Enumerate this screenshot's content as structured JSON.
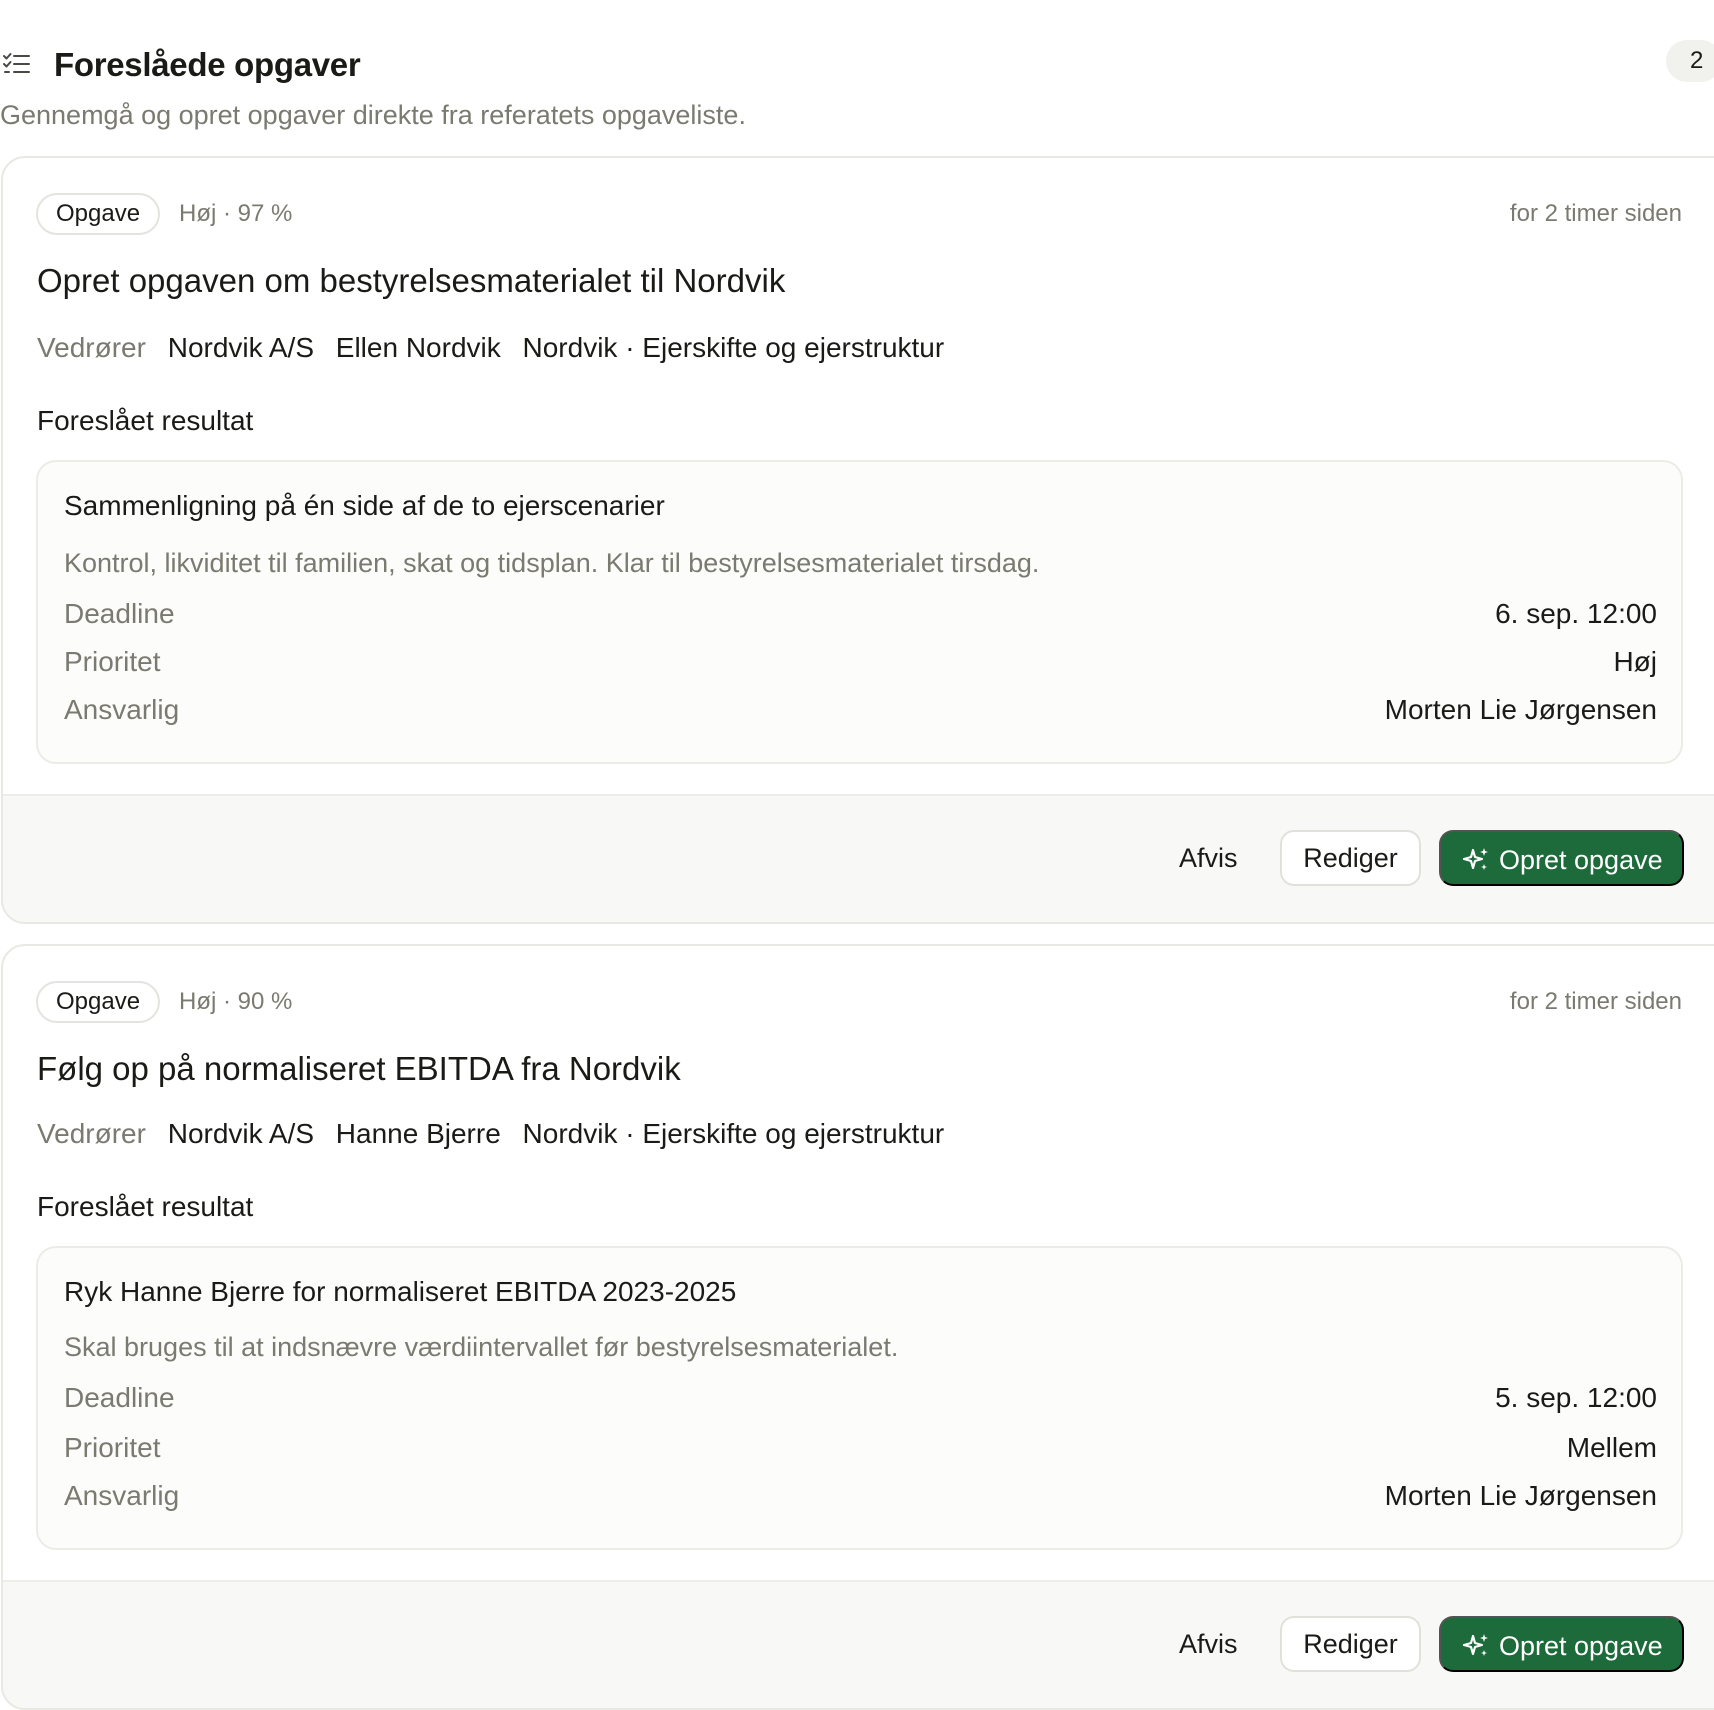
{
  "header": {
    "title": "Foreslåede opgaver",
    "count": "2",
    "subtitle": "Gennemgå og opret opgaver direkte fra referatets opgaveliste.",
    "icon": "list-check-icon"
  },
  "tasks": [
    {
      "type_label": "Opgave",
      "meta": "Høj · 97 %",
      "time": "for 2 timer siden",
      "title": "Opret opgaven om bestyrelsesmaterialet til Nordvik",
      "regards_label": "Vedrører",
      "regards": [
        "Nordvik A/S",
        "Ellen Nordvik",
        "Nordvik · Ejerskifte og ejerstruktur"
      ],
      "result_label": "Foreslået resultat",
      "result": {
        "title": "Sammenligning på én side af de to ejerscenarier",
        "description": "Kontrol, likviditet til familien, skat og tidsplan. Klar til bestyrelsesmaterialet tirsdag.",
        "fields": [
          {
            "label": "Deadline",
            "value": "6. sep. 12:00"
          },
          {
            "label": "Prioritet",
            "value": "Høj"
          },
          {
            "label": "Ansvarlig",
            "value": "Morten Lie Jørgensen"
          }
        ]
      },
      "actions": {
        "reject": "Afvis",
        "edit": "Rediger",
        "create": "Opret opgave"
      }
    },
    {
      "type_label": "Opgave",
      "meta": "Høj · 90 %",
      "time": "for 2 timer siden",
      "title": "Følg op på normaliseret EBITDA fra Nordvik",
      "regards_label": "Vedrører",
      "regards": [
        "Nordvik A/S",
        "Hanne Bjerre",
        "Nordvik · Ejerskifte og ejerstruktur"
      ],
      "result_label": "Foreslået resultat",
      "result": {
        "title": "Ryk Hanne Bjerre for normaliseret EBITDA 2023-2025",
        "description": "Skal bruges til at indsnævre værdiintervallet før bestyrelsesmaterialet.",
        "fields": [
          {
            "label": "Deadline",
            "value": "5. sep. 12:00"
          },
          {
            "label": "Prioritet",
            "value": "Mellem"
          },
          {
            "label": "Ansvarlig",
            "value": "Morten Lie Jørgensen"
          }
        ]
      },
      "actions": {
        "reject": "Afvis",
        "edit": "Rediger",
        "create": "Opret opgave"
      }
    }
  ],
  "colors": {
    "primary": "#1d6a3a",
    "muted_text": "#7a7a70",
    "text": "#1a1a17",
    "border": "#e9e9e4",
    "footer_bg": "#f8f8f6"
  }
}
